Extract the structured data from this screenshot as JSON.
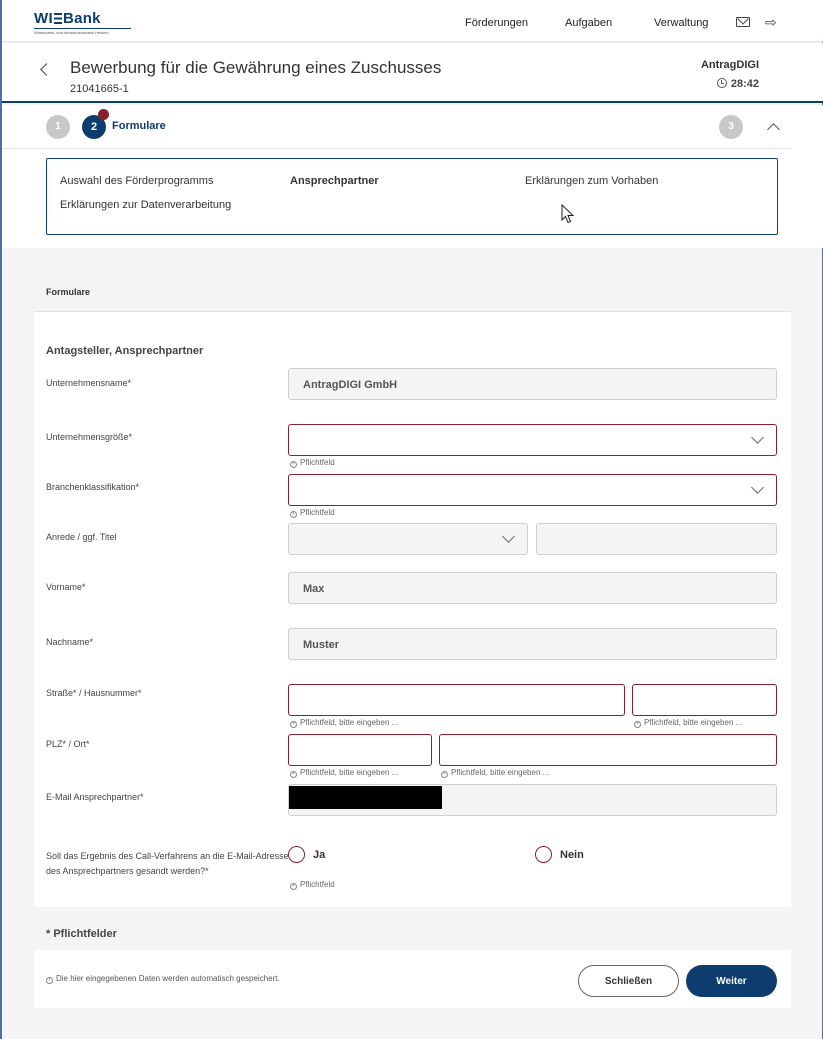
{
  "brand": {
    "logo_text_left": "WI",
    "logo_text_right": "Bank",
    "logo_tagline": "Wirtschafts- und Infrastrukturbank Hessen"
  },
  "nav": {
    "items": [
      "Förderungen",
      "Aufgaben",
      "Verwaltung"
    ],
    "icons": [
      "mail-icon",
      "logout-icon"
    ]
  },
  "header": {
    "title": "Bewerbung für die Gewährung eines Zuschusses",
    "subtitle": "21041665-1",
    "app_name": "AntragDIGI",
    "timer": "28:42"
  },
  "stepper": {
    "step1": "1",
    "step2": "2",
    "step2_label": "Formulare",
    "step3": "3"
  },
  "form_links": {
    "link1": "Auswahl des Förderprogramms",
    "link2": "Ansprechpartner",
    "link3": "Erklärungen zum Vorhaben",
    "link4": "Erklärungen zur Datenverarbeitung"
  },
  "panel": {
    "head": "Formulare",
    "section_title": "Antagsteller, Ansprechpartner",
    "fields": {
      "company_label": "Unternehmensname*",
      "company_value": "AntragDIGI GmbH",
      "size_label": "Unternehmensgröße*",
      "branch_label": "Branchenklassifikation*",
      "salutation_label": "Anrede / ggf. Titel",
      "firstname_label": "Vorname*",
      "firstname_value": "Max",
      "lastname_label": "Nachname*",
      "lastname_value": "Muster",
      "street_label": "Straße* / Hausnummer*",
      "plz_label": "PLZ* / Ort*",
      "email_label": "E-Mail Ansprechpartner*"
    },
    "hints": {
      "required": "Pflichtfeld",
      "required_enter": "Pflichtfeld, bitte eingeben ..."
    },
    "question": "Soll das Ergebnis des Call-Verfahrens an die E-Mail-Adresse des Ansprechpartners gesandt werden?*",
    "radio_yes": "Ja",
    "radio_no": "Nein",
    "required_note": "* Pflichtfelder",
    "autosave": "Die hier eingegebenen Daten werden automatisch gespeichert.",
    "autosave_icon": "info-icon",
    "btn_close": "Schließen",
    "btn_next": "Weiter"
  },
  "colors": {
    "primary": "#0d3c6e",
    "error": "#8a1f2e",
    "background": "#f4f4f4"
  }
}
